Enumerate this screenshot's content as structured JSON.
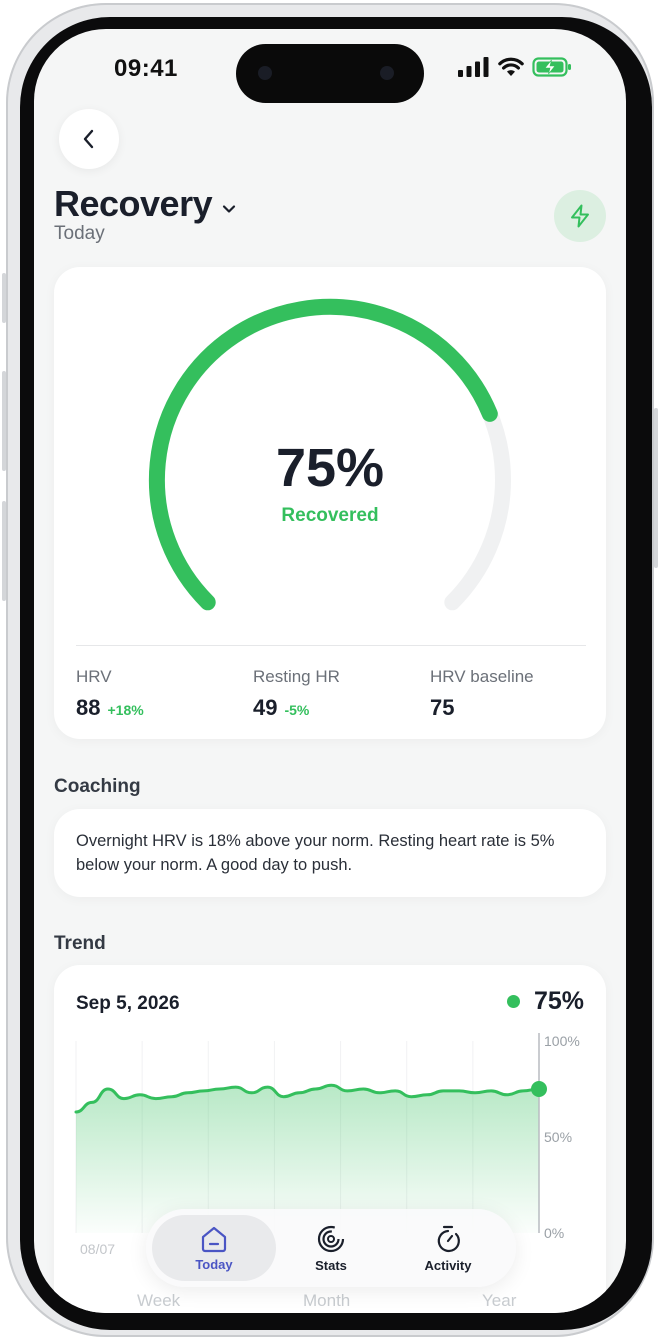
{
  "status_bar": {
    "time": "09:41"
  },
  "header": {
    "title": "Recovery",
    "subtitle": "Today"
  },
  "gauge": {
    "value_text": "75%",
    "value": 75,
    "label": "Recovered",
    "color": "#34bf5d"
  },
  "metrics": [
    {
      "label": "HRV",
      "value": "88",
      "delta": "+18%"
    },
    {
      "label": "Resting HR",
      "value": "49",
      "delta": "-5%"
    },
    {
      "label": "HRV baseline",
      "value": "75",
      "delta": ""
    }
  ],
  "coaching": {
    "heading": "Coaching",
    "text": "Overnight HRV is 18% above your norm. Resting heart rate is 5% below your norm. A good day to push."
  },
  "trend": {
    "heading": "Trend",
    "date": "Sep 5, 2026",
    "value_text": "75%",
    "y_ticks": [
      "100%",
      "50%",
      "0%"
    ],
    "x_start_label": "08/07"
  },
  "chart_data": {
    "type": "area",
    "ylim": [
      0,
      100
    ],
    "x": [
      "08/07",
      "",
      "",
      "",
      "",
      "",
      "",
      "",
      "",
      "",
      "",
      "",
      "",
      "",
      "",
      "",
      "",
      "",
      "",
      "",
      "",
      "",
      "",
      "",
      "",
      "",
      "",
      "",
      "",
      "09/05"
    ],
    "series": [
      {
        "values": [
          63,
          68,
          75,
          70,
          72,
          70,
          71,
          73,
          74,
          75,
          76,
          73,
          76,
          71,
          73,
          75,
          77,
          74,
          75,
          73,
          74,
          71,
          72,
          74,
          74,
          73,
          74,
          72,
          74,
          75
        ]
      }
    ]
  },
  "tabbar": {
    "tabs": [
      {
        "label": "Today",
        "active": true
      },
      {
        "label": "Stats",
        "active": false
      },
      {
        "label": "Activity",
        "active": false
      }
    ]
  },
  "range_labels": [
    "Week",
    "Month",
    "Year"
  ]
}
